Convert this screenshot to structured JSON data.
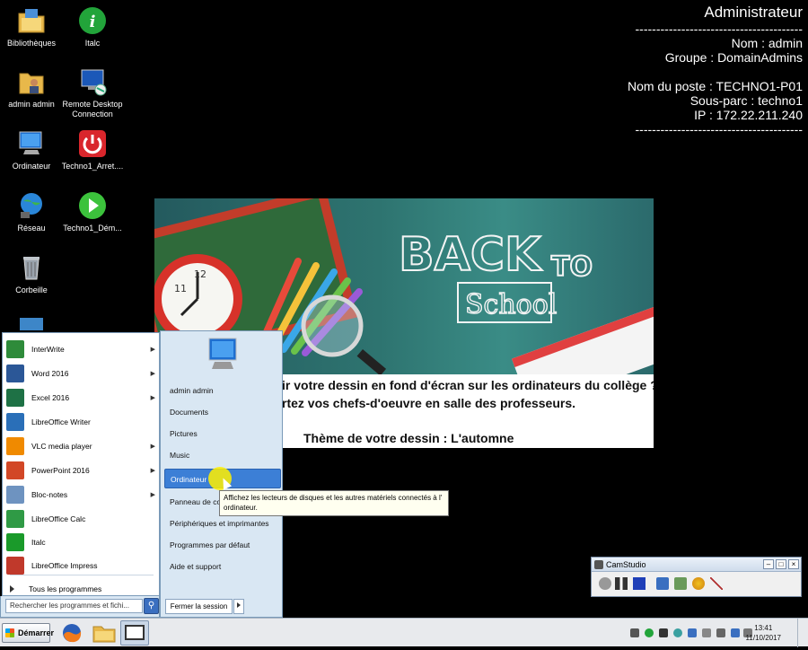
{
  "desktop_icons": [
    {
      "name": "bibliotheques",
      "label": "Bibliothèques"
    },
    {
      "name": "italc",
      "label": "Italc"
    },
    {
      "name": "admin-admin",
      "label": "admin admin"
    },
    {
      "name": "remote-desktop",
      "label": "Remote Desktop Connection"
    },
    {
      "name": "ordinateur",
      "label": "Ordinateur"
    },
    {
      "name": "techno1-arret",
      "label": "Techno1_Arret...."
    },
    {
      "name": "reseau",
      "label": "Réseau"
    },
    {
      "name": "techno1-dem",
      "label": "Techno1_Dém..."
    },
    {
      "name": "corbeille",
      "label": "Corbeille"
    }
  ],
  "bginfo": {
    "user": "Administrateur",
    "dashes": "----------------------------------------",
    "nom": "Nom : admin",
    "groupe": "Groupe : DomainAdmins",
    "poste": "Nom du poste : TECHNO1-P01",
    "sous_parc": "Sous-parc : techno1",
    "ip": "IP : 172.22.211.240"
  },
  "banner": {
    "back": "BACK",
    "to": "TO",
    "school": "School",
    "line1": "ir votre dessin en fond d'écran sur les ordinateurs du collège ?",
    "line2": "rtez vos chefs-d'oeuvre en salle des professeurs.",
    "line3": "Thème de votre dessin : L'automne"
  },
  "start_menu": {
    "programs": [
      {
        "label": "InterWrite",
        "has_arrow": true,
        "color": "#2e8b3a"
      },
      {
        "label": "Word 2016",
        "has_arrow": true,
        "color": "#2b5797"
      },
      {
        "label": "Excel 2016",
        "has_arrow": true,
        "color": "#1e7145"
      },
      {
        "label": "LibreOffice Writer",
        "has_arrow": false,
        "color": "#2a6fb8"
      },
      {
        "label": "VLC media player",
        "has_arrow": true,
        "color": "#f08a00"
      },
      {
        "label": "PowerPoint 2016",
        "has_arrow": true,
        "color": "#d24726"
      },
      {
        "label": "Bloc-notes",
        "has_arrow": true,
        "color": "#6e93c0"
      },
      {
        "label": "LibreOffice Calc",
        "has_arrow": false,
        "color": "#2f9a45"
      },
      {
        "label": "Italc",
        "has_arrow": false,
        "color": "#1a9a2a"
      },
      {
        "label": "LibreOffice Impress",
        "has_arrow": false,
        "color": "#c0392b"
      }
    ],
    "all_programs": "Tous les programmes",
    "search_placeholder": "Rechercher les programmes et fichi...",
    "right_items": [
      {
        "label": "admin admin"
      },
      {
        "label": "Documents"
      },
      {
        "label": "Pictures"
      },
      {
        "label": "Music"
      },
      {
        "label": "Ordinateur",
        "highlighted": true
      },
      {
        "label": "Panneau de co"
      },
      {
        "label": "Périphériques et imprimantes"
      },
      {
        "label": "Programmes par défaut"
      },
      {
        "label": "Aide et support"
      }
    ],
    "shutdown_label": "Fermer la session"
  },
  "tooltip": "Affichez les lecteurs de disques et les autres matériels connectés à l' ordinateur.",
  "camstudio": {
    "title": "CamStudio"
  },
  "taskbar": {
    "start_label": "Démarrer",
    "time": "13:41",
    "date": "11/10/2017"
  },
  "colors": {
    "menu_highlight": "#3c7fd6",
    "taskbar_bg": "#e8eaed",
    "desktop_bg": "#000000"
  }
}
